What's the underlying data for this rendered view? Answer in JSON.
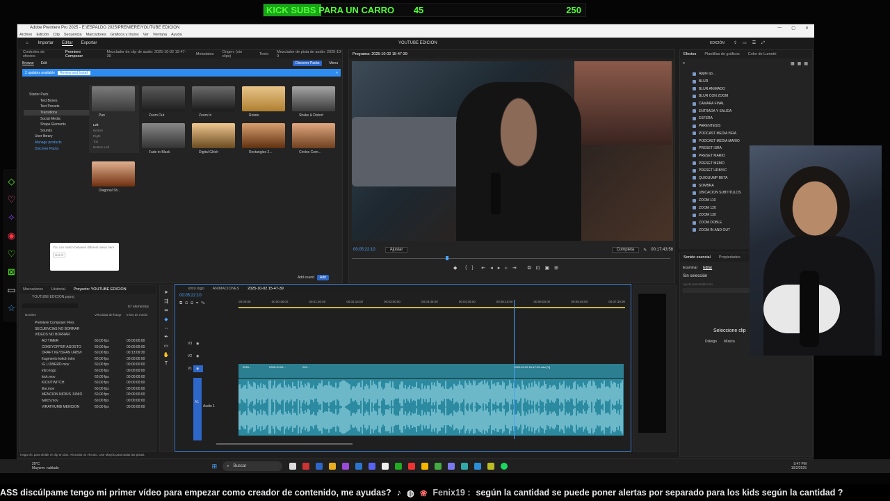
{
  "overlay": {
    "goal_text": "KICK SUBS PARA UN CARRO",
    "goal_current": "45",
    "goal_target": "250",
    "progress": 0.18,
    "ticker_left": "ASS discúlpame tengo mi primer vídeo para empezar como creador de contenido, me ayudas?",
    "ticker_user": "Fenix19 :",
    "ticker_right": "según la cantidad  se puede poner alertas por separado para los kids según la cantidad ?"
  },
  "window": {
    "title": "Adobe Premiere Pro 2025 - E:\\ESPALDO 2025\\PREMIERE\\YOUTUBE EDICION",
    "menu": [
      "Archivo",
      "Edición",
      "Clip",
      "Secuencia",
      "Marcadores",
      "Gráficos y títulos",
      "Ver",
      "Ventana",
      "Ayuda"
    ],
    "controls": [
      "—",
      "▢",
      "✕"
    ]
  },
  "workspace": {
    "tabs": [
      "Importar",
      "Editar",
      "Exportar"
    ],
    "active": "Editar",
    "project_title": "YOUTUBE EDICION",
    "right_label": "EDICIÓN"
  },
  "source_panel": {
    "tabs": [
      "Controles de efectos",
      "Premiere Composer",
      "Mezclador de clip de audio: 2025-10-02 15-47-39",
      "Metadatos",
      "Origen: (sin clips)",
      "Texto",
      "Mezclador de pista de audio: 2025-10-0"
    ],
    "subtabs": [
      "Browse",
      "Edit"
    ],
    "discover_btn": "Discover Packs",
    "menu_btn": "Menu",
    "update_text": "2 updates available",
    "update_btn": "Review and Install",
    "tree": [
      "Starter Pack",
      "Text Boxes",
      "Text Presets",
      "Transitions",
      "Social Media",
      "Shape Elements",
      "Sounds",
      "User library",
      "Manage products",
      "Discover Packs"
    ],
    "thumbs": [
      "Pan",
      "Zoom Out",
      "Zoom In",
      "Rotate",
      "Shake & Distort",
      "Fade to Black",
      "Digital Glitch",
      "Rectangles 2...",
      "Circles Corn...",
      "Diagonal Sh..."
    ],
    "pan_options": [
      "Left",
      "Bottom",
      "Right",
      "Top",
      "Bottom Left"
    ],
    "tooltip_text": "You can switch between different views here",
    "tooltip_btn": "Got it!",
    "add_sound": "Add sound",
    "add_btn": "Add"
  },
  "program": {
    "title": "Programa: 2025-10-02 15-47-39",
    "timecode": "00:05:22:10",
    "fit": "Ajustar",
    "quality": "Completa",
    "duration": "00:17:43:58"
  },
  "effects": {
    "tabs": [
      "Efectos",
      "Plantillas de gráficos",
      "Color de Lumetri"
    ],
    "items": [
      "Apple ap...",
      "BLUR",
      "BLUR ANIMADO",
      "BLUR CON ZOOM",
      "CAMARA FINAL",
      "ENTRADA Y SALIDA",
      "ESFERA",
      "PARENTESIS",
      "PODCAST MEDIA ISRA",
      "PODCAST MEDIA MARIO",
      "PRESET ISRA",
      "PRESET MARIO",
      "PRESET MEMO",
      "PRESET URBVIC",
      "QUIOUUMP BETA",
      "SOMBRA",
      "UBICACION SUBTITULOS",
      "ZOOM 110",
      "ZOOM 120",
      "ZOOM 130",
      "ZOOM DOBLE",
      "ZOOM IN AND OUT"
    ]
  },
  "essential_sound": {
    "tabs": [
      "Sonido esencial",
      "Propiedades"
    ],
    "subtabs": [
      "Examinar",
      "Editar"
    ],
    "no_selection": "Sin selección",
    "preset": "Ajuste preestablecido",
    "select_clip": "Seleccione clip",
    "dialog": "Diálogo",
    "music": "Música"
  },
  "project": {
    "tabs": [
      "Marcadores",
      "Historial",
      "Proyecto: YOUTUBE EDICION"
    ],
    "file": "YOUTUBE EDICION.prproj",
    "count": "67 elementos",
    "columns": [
      "Nombre",
      "Velocidad de fotogr",
      "Inicio de medio"
    ],
    "rows": [
      {
        "name": "Premiere Composer Files",
        "fps": "",
        "start": ""
      },
      {
        "name": "SECUENCIAS NO BORRAR",
        "fps": "",
        "start": ""
      },
      {
        "name": "VIDEOS NO BORRAR",
        "fps": "",
        "start": ""
      },
      {
        "name": "AO TIMER",
        "fps": "60,00 fps",
        "start": "00:00:00:00"
      },
      {
        "name": "CDKEYOFFER AGOSTO",
        "fps": "60,00 fps",
        "start": "00:00:00:00"
      },
      {
        "name": "DRAFT KEYSFAN URBVI",
        "fps": "60,00 fps",
        "start": "00:13:09:30"
      },
      {
        "name": "fragmento twitch intro",
        "fps": "60,00 fps",
        "start": "00:00:00:00"
      },
      {
        "name": "IG LOWERD.mov",
        "fps": "60,00 fps",
        "start": "00:00:00:00"
      },
      {
        "name": "intro logo",
        "fps": "60,00 fps",
        "start": "00:00:00:00"
      },
      {
        "name": "kick.mov",
        "fps": "60,00 fps",
        "start": "00:00:00:00"
      },
      {
        "name": "KICK/TWITCH",
        "fps": "60,00 fps",
        "start": "00:00:00:00"
      },
      {
        "name": "like.mov",
        "fps": "60,00 fps",
        "start": "00:00:00:00"
      },
      {
        "name": "MENCION NIDIUS JUNIO",
        "fps": "60,00 fps",
        "start": "00:00:00:00"
      },
      {
        "name": "twitch.mov",
        "fps": "60,00 fps",
        "start": "00:00:00:00"
      },
      {
        "name": "VIRATHUMB MENCION",
        "fps": "60,00 fps",
        "start": "00:00:00:00"
      }
    ]
  },
  "timeline": {
    "tabs": [
      "intro logo",
      "ANIMACIONES",
      "2025-10-02 15-47-39"
    ],
    "timecode": "00:05:22:10",
    "ruler": [
      "00:00:00",
      "00:00:45:00",
      "00:01:30:00",
      "00:02:15:00",
      "00:03:00:00",
      "00:03:45:00",
      "00:04:30:00",
      "00:05:15:00",
      "00:06:00:00",
      "00:06:45:00",
      "00:07:30:00"
    ],
    "tracks": [
      "V3",
      "V2",
      "V1",
      "A1"
    ],
    "audio_track_label": "Audio 1",
    "clip_long": "2025-10-02 15-47-39.mkv [V]",
    "clip_labels": [
      "2025...",
      "2025-10-02...",
      "202..."
    ]
  },
  "status": {
    "hint": "Haga clic para dividir el clip en dos. Alt anula un vínculo. Use Mayús para todas las pistas."
  },
  "taskbar": {
    "weather_temp": "20°C",
    "weather_desc": "Mayorm. nublado",
    "search": "Buscar",
    "time": "9:47 PM",
    "date": "10/2/2025"
  }
}
